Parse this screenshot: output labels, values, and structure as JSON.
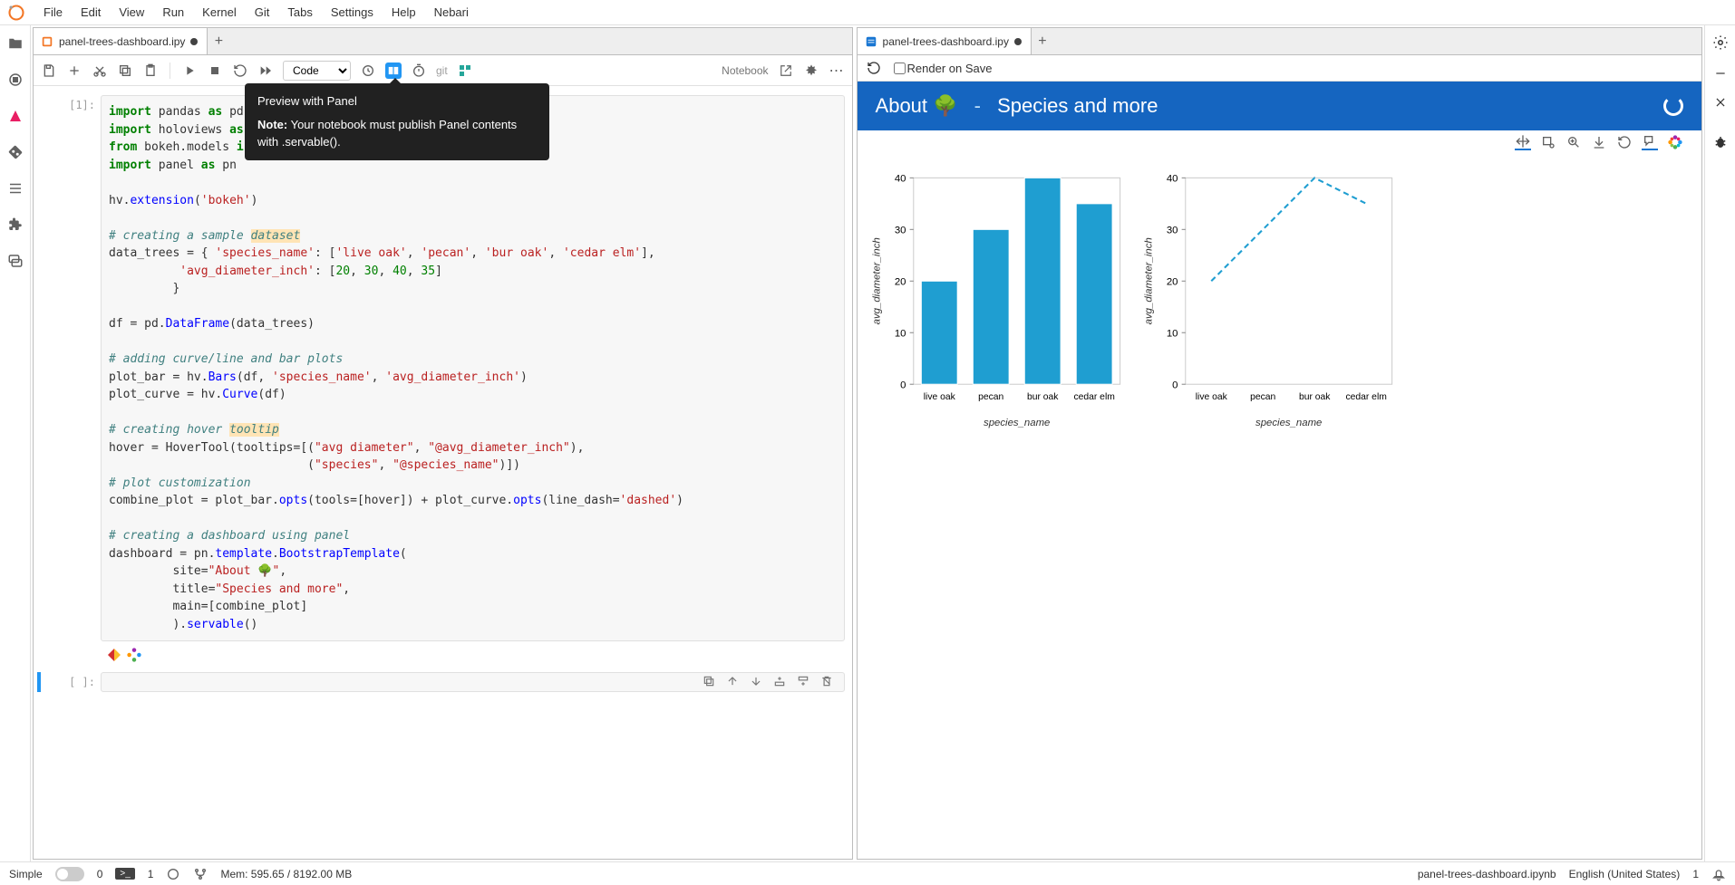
{
  "menu": {
    "items": [
      "File",
      "Edit",
      "View",
      "Run",
      "Kernel",
      "Git",
      "Tabs",
      "Settings",
      "Help",
      "Nebari"
    ]
  },
  "tabs": {
    "left": {
      "label": "panel-trees-dashboard.ipy",
      "modified": true
    },
    "right": {
      "label": "panel-trees-dashboard.ipy",
      "modified": true
    }
  },
  "nb_toolbar": {
    "cell_type": "Code",
    "right_label": "Notebook",
    "git_label": "git"
  },
  "tooltip": {
    "title": "Preview with Panel",
    "note_label": "Note:",
    "note_text": " Your notebook must publish Panel contents with .servable()."
  },
  "cell1": {
    "prompt": "[1]:"
  },
  "cell2": {
    "prompt": "[ ]:"
  },
  "preview": {
    "render_label": "Render on Save",
    "site": "About 🌳",
    "sep": "-",
    "title": "Species and more"
  },
  "chart_data": [
    {
      "type": "bar",
      "categories": [
        "live oak",
        "pecan",
        "bur oak",
        "cedar elm"
      ],
      "values": [
        20,
        30,
        40,
        35
      ],
      "xlabel": "species_name",
      "ylabel": "avg_diameter_inch",
      "ylim": [
        0,
        40
      ],
      "yticks": [
        0,
        10,
        20,
        30,
        40
      ]
    },
    {
      "type": "line",
      "categories": [
        "live oak",
        "pecan",
        "bur oak",
        "cedar elm"
      ],
      "values": [
        20,
        30,
        40,
        35
      ],
      "xlabel": "species_name",
      "ylabel": "avg_diameter_inch",
      "ylim": [
        0,
        40
      ],
      "yticks": [
        0,
        10,
        20,
        30,
        40
      ],
      "line_dash": "dashed"
    }
  ],
  "statusbar": {
    "simple": "Simple",
    "tabs_count": "0",
    "terms_count": "1",
    "mem": "Mem: 595.65 / 8192.00 MB",
    "file": "panel-trees-dashboard.ipynb",
    "lang": "English (United States)",
    "mode": "1"
  }
}
